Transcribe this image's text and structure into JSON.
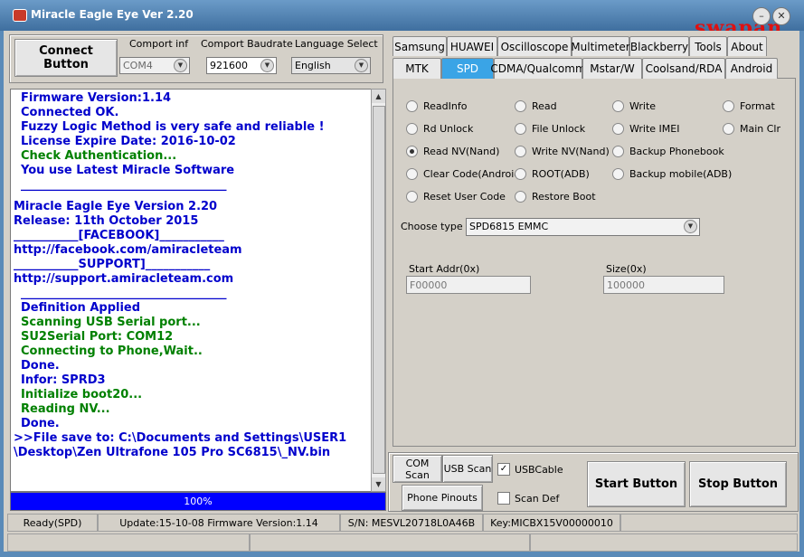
{
  "window": {
    "title": "Miracle Eagle Eye  Ver 2.20",
    "watermark": "swapan"
  },
  "top": {
    "connect_label": "Connect Button",
    "comport_label": "Comport inf",
    "comport_value": "COM4",
    "baud_label": "Comport Baudrate",
    "baud_value": "921600",
    "lang_label": "Language Select",
    "lang_value": "English"
  },
  "log": {
    "lines": [
      {
        "text": "Firmware Version:1.14",
        "color": "blue"
      },
      {
        "text": "Connected OK.",
        "color": "blue"
      },
      {
        "text": "Fuzzy Logic Method is very safe and reliable !",
        "color": "blue"
      },
      {
        "text": "License Expire Date: 2016-10-02",
        "color": "blue"
      },
      {
        "text": "Check Authentication...",
        "color": "green"
      },
      {
        "text": "You use Latest Miracle Software",
        "color": "blue"
      },
      {
        "text": "___________________________________",
        "color": "blue"
      },
      {
        "text": "Miracle Eagle Eye Version 2.20",
        "color": "blue"
      },
      {
        "text": "Release: 11th October 2015",
        "color": "blue"
      },
      {
        "text": "___________[FACEBOOK]___________",
        "color": "blue"
      },
      {
        "text": "http://facebook.com/amiracleteam",
        "color": "blue"
      },
      {
        "text": "___________SUPPORT]___________",
        "color": "blue"
      },
      {
        "text": "http://support.amiracleteam.com",
        "color": "blue"
      },
      {
        "text": "___________________________________",
        "color": "blue"
      },
      {
        "text": "Definition Applied",
        "color": "blue"
      },
      {
        "text": "Scanning USB Serial port...",
        "color": "green"
      },
      {
        "text": "SU2Serial Port: COM12",
        "color": "green"
      },
      {
        "text": "Connecting to Phone,Wait..",
        "color": "green"
      },
      {
        "text": "Done.",
        "color": "blue"
      },
      {
        "text": "Infor: SPRD3",
        "color": "blue"
      },
      {
        "text": "Initialize boot20...",
        "color": "green"
      },
      {
        "text": "Reading NV...",
        "color": "green"
      },
      {
        "text": "Done.",
        "color": "blue"
      },
      {
        "text": ">>File save to: C:\\Documents and Settings\\USER1",
        "color": "blue"
      },
      {
        "text": "\\Desktop\\Zen Ultrafone 105 Pro SC6815\\_NV.bin",
        "color": "blue"
      }
    ],
    "progress_text": "100%",
    "progress_fraction": 1.0
  },
  "tabs_row1": [
    "Samsung",
    "HUAWEI",
    "Oscilloscope",
    "Multimeter",
    "Blackberry",
    "Tools",
    "About"
  ],
  "tabs_row2": [
    "MTK",
    "SPD",
    "CDMA/Qualcomm",
    "Mstar/W",
    "Coolsand/RDA",
    "Android"
  ],
  "active_tab": "SPD",
  "options": [
    "ReadInfo",
    "Read",
    "Write",
    "Format",
    "Rd Unlock",
    "File Unlock",
    "Write IMEI",
    "Main Clr",
    "Read NV(Nand)",
    "Write NV(Nand)",
    "Backup Phonebook",
    "Clear Code(Android)",
    "ROOT(ADB)",
    "Backup mobile(ADB)",
    "Reset User Code",
    "Restore Boot"
  ],
  "selected_option": "Read NV(Nand)",
  "choose_type": {
    "label": "Choose  type",
    "value": "SPD6815 EMMC"
  },
  "start_addr": {
    "label": "Start Addr(0x)",
    "value": "F00000"
  },
  "size": {
    "label": "Size(0x)",
    "value": "100000"
  },
  "bottom": {
    "com_scan": "COM Scan",
    "usb_scan": "USB Scan",
    "usb_cable": "USBCable",
    "usb_cable_checked": true,
    "phone_pinouts": "Phone Pinouts",
    "scan_def": "Scan Def",
    "scan_def_checked": false,
    "start": "Start Button",
    "stop": "Stop Button"
  },
  "statusbar": {
    "ready": "Ready(SPD)",
    "update": "Update:15-10-08  Firmware Version:1.14",
    "sn": "S/N: MESVL20718L0A46B",
    "key": "Key:MICBX15V00000010"
  }
}
